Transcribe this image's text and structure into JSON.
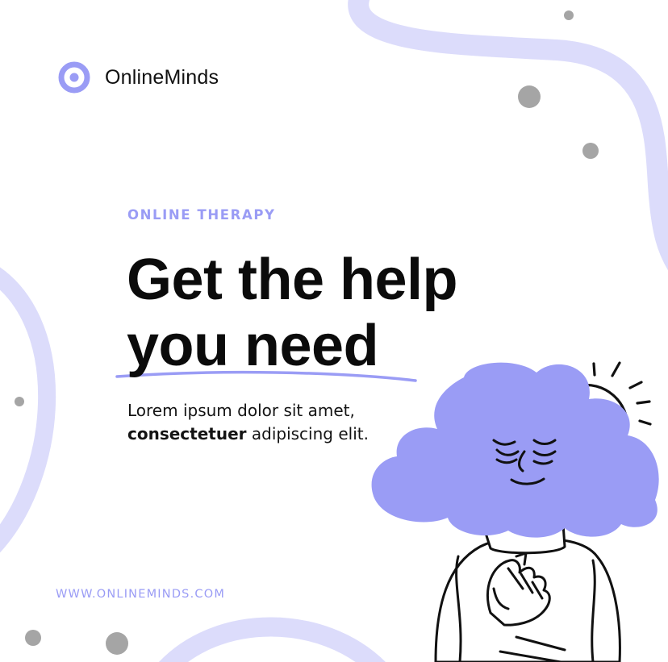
{
  "brand": {
    "name": "OnlineMinds",
    "logo_icon": "target-ring-icon"
  },
  "hero": {
    "eyebrow": "ONLINE THERAPY",
    "headline_line1": "Get the help",
    "headline_line2": "you need",
    "body_line1": "Lorem ipsum dolor sit amet,",
    "body_line2_bold": "consectetuer",
    "body_line2_rest": " adipiscing elit."
  },
  "footer": {
    "url": "WWW.ONLINEMINDS.COM"
  },
  "illustration": {
    "name": "cloud-head-person-illustration",
    "icons": [
      "sun-icon"
    ]
  },
  "colors": {
    "accent": "#9a9cf5",
    "accent_light": "#dcdcfb",
    "text": "#0b0b0b",
    "dot_gray": "#a5a5a5",
    "background": "#ffffff"
  }
}
